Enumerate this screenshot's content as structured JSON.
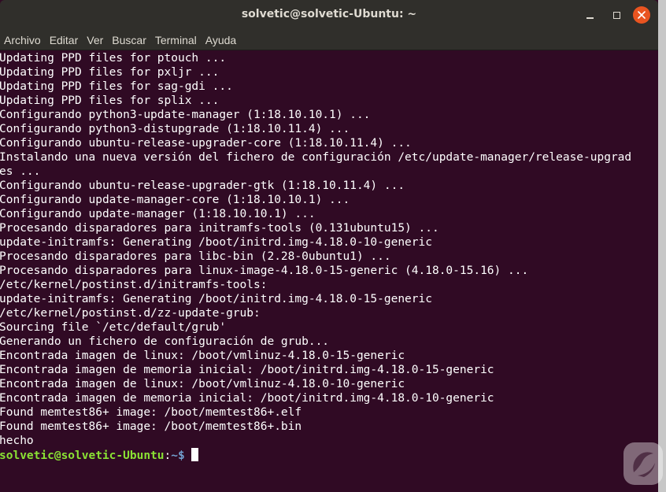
{
  "window": {
    "title": "solvetic@solvetic-Ubuntu: ~",
    "minimize_icon": "minimize-icon",
    "maximize_icon": "maximize-icon",
    "close_icon": "close-icon",
    "close_color": "#e95420"
  },
  "menu": [
    "Archivo",
    "Editar",
    "Ver",
    "Buscar",
    "Terminal",
    "Ayuda"
  ],
  "terminal": {
    "background": "#300a24",
    "lines": [
      "Updating PPD files for ptouch ...",
      "Updating PPD files for pxljr ...",
      "Updating PPD files for sag-gdi ...",
      "Updating PPD files for splix ...",
      "Configurando python3-update-manager (1:18.10.10.1) ...",
      "Configurando python3-distupgrade (1:18.10.11.4) ...",
      "Configurando ubuntu-release-upgrader-core (1:18.10.11.4) ...",
      "Instalando una nueva versión del fichero de configuración /etc/update-manager/release-upgrad",
      "es ...",
      "Configurando ubuntu-release-upgrader-gtk (1:18.10.11.4) ...",
      "Configurando update-manager-core (1:18.10.10.1) ...",
      "Configurando update-manager (1:18.10.10.1) ...",
      "Procesando disparadores para initramfs-tools (0.131ubuntu15) ...",
      "update-initramfs: Generating /boot/initrd.img-4.18.0-10-generic",
      "Procesando disparadores para libc-bin (2.28-0ubuntu1) ...",
      "Procesando disparadores para linux-image-4.18.0-15-generic (4.18.0-15.16) ...",
      "/etc/kernel/postinst.d/initramfs-tools:",
      "update-initramfs: Generating /boot/initrd.img-4.18.0-15-generic",
      "/etc/kernel/postinst.d/zz-update-grub:",
      "Sourcing file `/etc/default/grub'",
      "Generando un fichero de configuración de grub...",
      "Encontrada imagen de linux: /boot/vmlinuz-4.18.0-15-generic",
      "Encontrada imagen de memoria inicial: /boot/initrd.img-4.18.0-15-generic",
      "Encontrada imagen de linux: /boot/vmlinuz-4.18.0-10-generic",
      "Encontrada imagen de memoria inicial: /boot/initrd.img-4.18.0-10-generic",
      "Found memtest86+ image: /boot/memtest86+.elf",
      "Found memtest86+ image: /boot/memtest86+.bin",
      "hecho"
    ],
    "prompt": {
      "user_host": "solvetic@solvetic-Ubuntu",
      "colon": ":",
      "path": "~$"
    }
  }
}
